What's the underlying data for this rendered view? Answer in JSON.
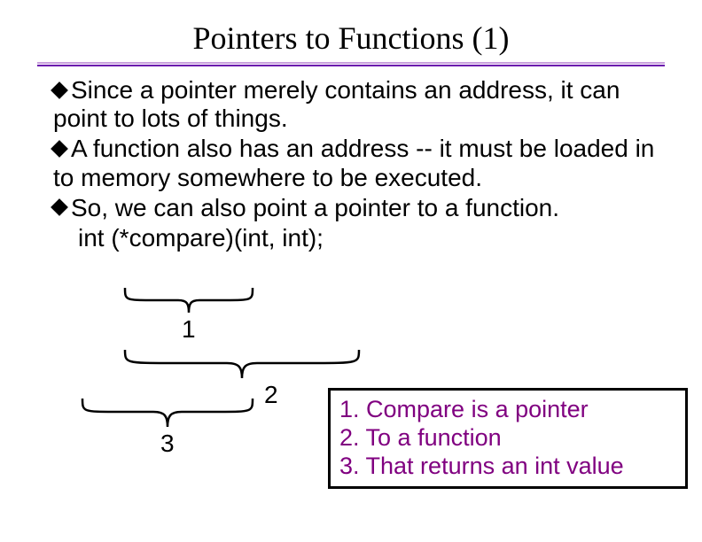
{
  "title": "Pointers to Functions (1)",
  "bullets": [
    "Since a pointer merely contains an address, it can point to lots of things.",
    "A function also has an address -- it must be loaded in to memory somewhere to be executed.",
    "So, we can also point a pointer to a function."
  ],
  "code": "int (*compare)(int, int);",
  "labels": {
    "l1": "1",
    "l2": "2",
    "l3": "3"
  },
  "legend": {
    "line1": "1. Compare is a pointer",
    "line2": "2. To a function",
    "line3": "3. That returns an int value"
  }
}
